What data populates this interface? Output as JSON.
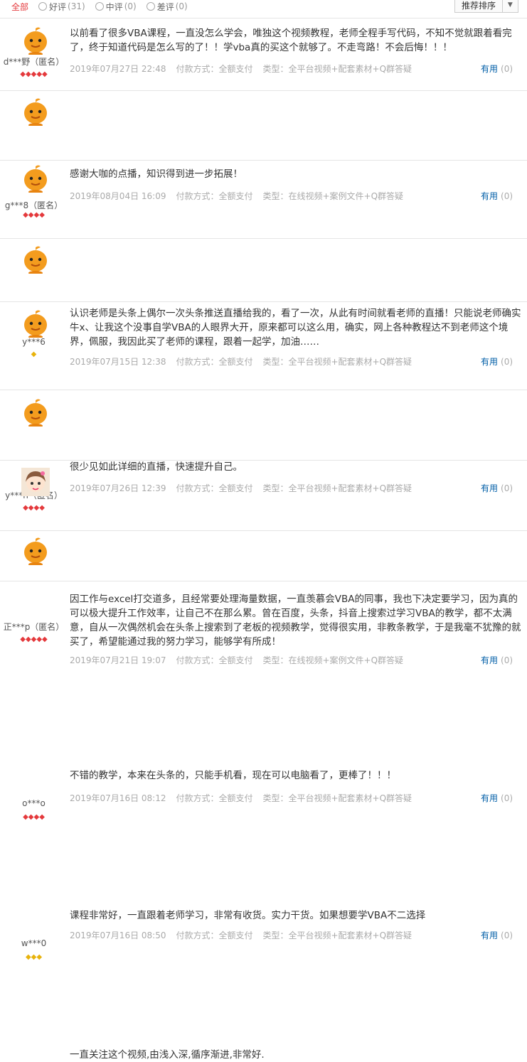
{
  "filter": {
    "tabs": [
      {
        "label": "全部",
        "count": ""
      },
      {
        "label": "好评",
        "count": "(31)"
      },
      {
        "label": "中评",
        "count": "(0)"
      },
      {
        "label": "差评",
        "count": "(0)"
      }
    ],
    "sort_label": "推荐排序",
    "sort_icon": "chevron-down-icon"
  },
  "colors": {
    "accent": "#e4393c",
    "link": "#005ea7",
    "avatar_orange": "#f39c1e",
    "meta": "#aaaaaa"
  },
  "reviews": [
    {
      "user": "d***野（匿名）",
      "rank_level": 5,
      "rank_type": "red-diamond",
      "content": "以前看了很多VBA课程，一直没怎么学会，唯独这个视频教程，老师全程手写代码，不知不觉就跟着看完了，终于知道代码是怎么写的了！！学vba真的买这个就够了。不走弯路！不会后悔！！！",
      "date": "2019年07月27日 22:48",
      "payment": "付款方式：全额支付",
      "type": "类型：全平台视频+配套素材+Q群答疑",
      "useful_label": "有用",
      "useful_count": "(0)"
    },
    {
      "user": "g***8（匿名）",
      "rank_level": 4,
      "rank_type": "red-diamond",
      "content": "感谢大咖的点播，知识得到进一步拓展！",
      "date": "2019年08月04日 16:09",
      "payment": "付款方式：全额支付",
      "type": "类型：在线视频+案例文件+Q群答疑",
      "useful_label": "有用",
      "useful_count": "(0)"
    },
    {
      "user": "y***6",
      "rank_level": 1,
      "rank_type": "gold-diamond",
      "content": "认识老师是头条上偶尔一次头条推送直播给我的，看了一次，从此有时间就看老师的直播！只能说老师确实牛x、让我这个没事自学VBA的人眼界大开，原来都可以这么用，确实，网上各种教程达不到老师这个境界，佩服，我因此买了老师的课程，跟着一起学，加油……",
      "date": "2019年07月15日 12:38",
      "payment": "付款方式：全额支付",
      "type": "类型：全平台视频+配套素材+Q群答疑",
      "useful_label": "有用",
      "useful_count": "(0)"
    },
    {
      "user": "y***n（匿名）",
      "rank_level": 4,
      "rank_type": "red-diamond",
      "content": "很少见如此详细的直播，快速提升自己。",
      "date": "2019年07月26日 12:39",
      "payment": "付款方式：全额支付",
      "type": "类型：全平台视频+配套素材+Q群答疑",
      "useful_label": "有用",
      "useful_count": "(0)"
    },
    {
      "user": "正***p（匿名）",
      "rank_level": 5,
      "rank_type": "red-diamond",
      "content": "因工作与excel打交道多，且经常要处理海量数据，一直羡慕会VBA的同事，我也下决定要学习，因为真的可以极大提升工作效率，让自己不在那么累。曾在百度，头条，抖音上搜索过学习VBA的教学，都不太满意，自从一次偶然机会在头条上搜索到了老板的视频教学，觉得很实用，非教条教学，于是我毫不犹豫的就买了，希望能通过我的努力学习，能够学有所成！",
      "date": "2019年07月21日 19:07",
      "payment": "付款方式：全额支付",
      "type": "类型：在线视频+案例文件+Q群答疑",
      "useful_label": "有用",
      "useful_count": "(0)"
    },
    {
      "user": "o***o",
      "rank_level": 4,
      "rank_type": "red-diamond",
      "content": "不错的教学，本来在头条的，只能手机看，现在可以电脑看了，更棒了！！！",
      "date": "2019年07月16日 08:12",
      "payment": "付款方式：全额支付",
      "type": "类型：全平台视频+配套素材+Q群答疑",
      "useful_label": "有用",
      "useful_count": "(0)"
    },
    {
      "user": "w***0",
      "rank_level": 3,
      "rank_type": "gold-diamond",
      "content": "课程非常好，一直跟着老师学习，非常有收货。实力干货。如果想要学VBA不二选择",
      "date": "2019年07月16日 08:50",
      "payment": "付款方式：全额支付",
      "type": "类型：全平台视频+配套素材+Q群答疑",
      "useful_label": "有用",
      "useful_count": "(0)"
    },
    {
      "user": "",
      "rank_level": 0,
      "rank_type": "",
      "content": "一直关注这个视频,由浅入深,循序渐进,非常好.",
      "date": "",
      "payment": "",
      "type": "",
      "useful_label": "",
      "useful_count": ""
    }
  ]
}
